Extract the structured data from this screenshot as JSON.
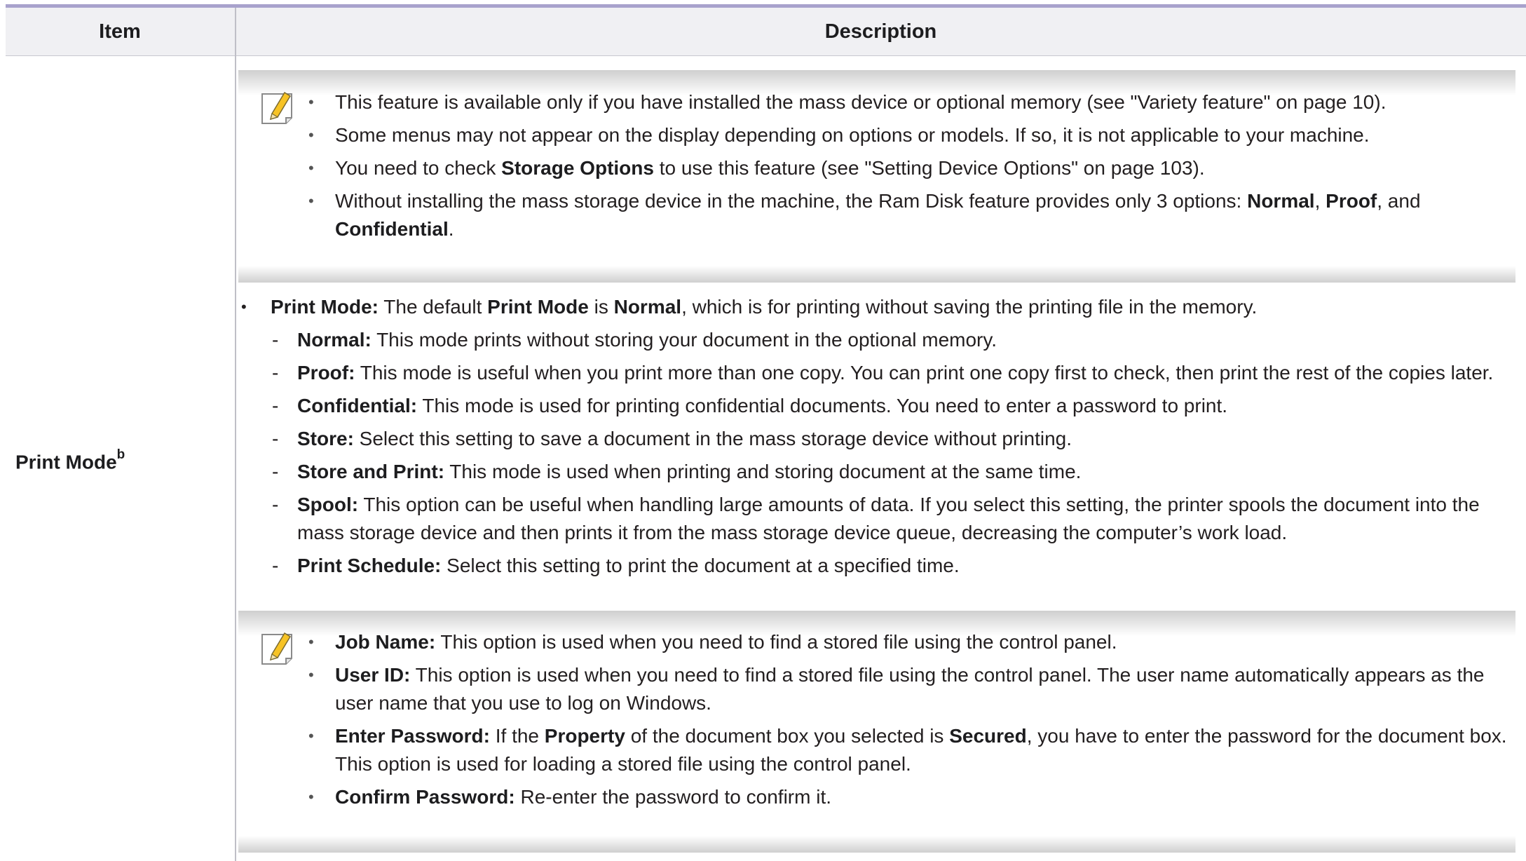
{
  "table": {
    "headers": {
      "item": "Item",
      "description": "Description"
    }
  },
  "row": {
    "item_label": "Print Mode",
    "item_sup": "b"
  },
  "note1": {
    "icon": "note-pencil-icon",
    "bullets": [
      {
        "parts": [
          {
            "t": " This feature is available only if you have installed the mass device or optional memory (see \"Variety feature\" on page 10).",
            "b": false
          }
        ]
      },
      {
        "parts": [
          {
            "t": "Some menus may not appear on the display depending on options or models. If so, it is not applicable to your machine.",
            "b": false
          }
        ]
      },
      {
        "parts": [
          {
            "t": "You need to check ",
            "b": false
          },
          {
            "t": "Storage Options",
            "b": true
          },
          {
            "t": " to use this feature (see \"Setting Device Options\" on page 103).",
            "b": false
          }
        ]
      },
      {
        "parts": [
          {
            "t": "Without installing the mass storage device in the machine, the Ram Disk feature provides only 3 options: ",
            "b": false
          },
          {
            "t": "Normal",
            "b": true
          },
          {
            "t": ", ",
            "b": false
          },
          {
            "t": "Proof",
            "b": true
          },
          {
            "t": ", and ",
            "b": false
          },
          {
            "t": "Confidential",
            "b": true
          },
          {
            "t": ".",
            "b": false
          }
        ]
      }
    ]
  },
  "print_mode": {
    "intro": [
      {
        "t": "Print Mode:",
        "b": true
      },
      {
        "t": " The default ",
        "b": false
      },
      {
        "t": "Print Mode",
        "b": true
      },
      {
        "t": " is ",
        "b": false
      },
      {
        "t": "Normal",
        "b": true
      },
      {
        "t": ", which is for printing without saving the printing file in the memory.",
        "b": false
      }
    ],
    "dash": "-",
    "options": [
      {
        "label": "Normal:",
        "text": " This mode prints without storing your document in the optional memory."
      },
      {
        "label": "Proof:",
        "text": " This mode is useful when you print more than one copy. You can print one copy first to check, then print the rest of the copies later."
      },
      {
        "label": "Confidential:",
        "text": " This mode is used for printing confidential documents. You need to enter a password to print."
      },
      {
        "label": "Store:",
        "text": " Select this setting to save a document in the mass storage device without printing."
      },
      {
        "label": "Store and Print:",
        "text": " This mode is used when printing and storing document at the same time."
      },
      {
        "label": "Spool:",
        "text": " This option can be useful when handling large amounts of data. If you select this setting, the printer spools the document into the mass storage device and then prints it from the mass storage device queue, decreasing the computer’s work load."
      },
      {
        "label": "Print Schedule:",
        "text": " Select this setting to print the document at a specified time."
      }
    ]
  },
  "note2": {
    "icon": "note-pencil-icon",
    "bullets": [
      {
        "parts": [
          {
            "t": "Job Name:",
            "b": true
          },
          {
            "t": " This option is used when you need to find a stored file using the control panel.",
            "b": false
          }
        ]
      },
      {
        "parts": [
          {
            "t": "User ID:",
            "b": true
          },
          {
            "t": " This option is used when you need to find a stored file using the control panel. The user name automatically appears as the user name that you use to log on Windows.",
            "b": false
          }
        ]
      },
      {
        "parts": [
          {
            "t": "Enter Password:",
            "b": true
          },
          {
            "t": " If the ",
            "b": false
          },
          {
            "t": "Property",
            "b": true
          },
          {
            "t": " of the document box you selected is ",
            "b": false
          },
          {
            "t": "Secured",
            "b": true
          },
          {
            "t": ", you have to enter the password for the document box.  This option is used for loading a stored file using the control panel.",
            "b": false
          }
        ]
      },
      {
        "parts": [
          {
            "t": "Confirm Password:",
            "b": true
          },
          {
            "t": " Re-enter the password to confirm it.",
            "b": false
          }
        ]
      }
    ]
  },
  "bullet_char": "•",
  "colors": {
    "rule": "#a8a2cc",
    "header_bg": "#f0f0f3",
    "text": "#231f20",
    "icon_accent": "#f7c325"
  }
}
